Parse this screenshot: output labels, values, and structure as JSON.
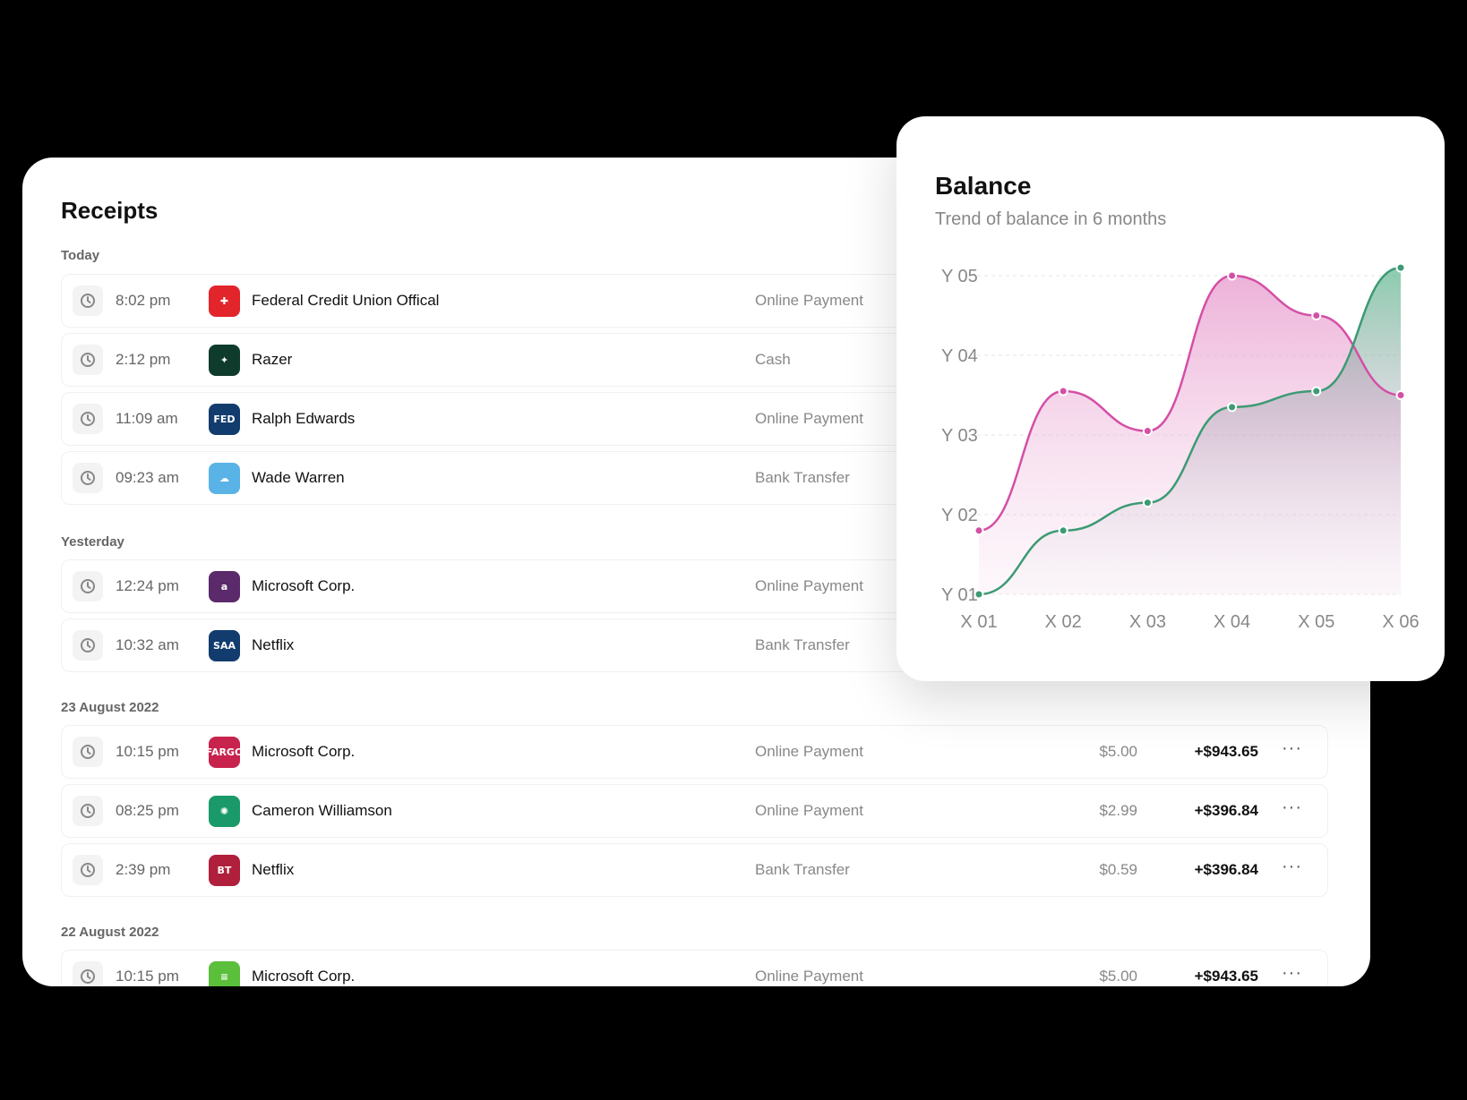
{
  "receipts": {
    "title": "Receipts",
    "groups": [
      {
        "label": "Today",
        "rows": [
          {
            "time": "8:02 pm",
            "name": "Federal Credit Union Offical",
            "method": "Online Payment",
            "fee": "",
            "amount": "",
            "logo_color": "#e2242b",
            "logo_text": "✚"
          },
          {
            "time": "2:12 pm",
            "name": "Razer",
            "method": "Cash",
            "fee": "",
            "amount": "",
            "logo_color": "#0f3b2c",
            "logo_text": "✦"
          },
          {
            "time": "11:09 am",
            "name": "Ralph Edwards",
            "method": "Online Payment",
            "fee": "",
            "amount": "",
            "logo_color": "#123c6e",
            "logo_text": "FED"
          },
          {
            "time": "09:23 am",
            "name": "Wade Warren",
            "method": "Bank Transfer",
            "fee": "",
            "amount": "",
            "logo_color": "#5ab3e6",
            "logo_text": "☁"
          }
        ]
      },
      {
        "label": "Yesterday",
        "rows": [
          {
            "time": "12:24 pm",
            "name": "Microsoft Corp.",
            "method": "Online Payment",
            "fee": "",
            "amount": "",
            "logo_color": "#5b2a6b",
            "logo_text": "a"
          },
          {
            "time": "10:32 am",
            "name": "Netflix",
            "method": "Bank Transfer",
            "fee": "",
            "amount": "",
            "logo_color": "#123c6e",
            "logo_text": "SAA"
          }
        ]
      },
      {
        "label": "23 August 2022",
        "rows": [
          {
            "time": "10:15 pm",
            "name": "Microsoft Corp.",
            "method": "Online Payment",
            "fee": "$5.00",
            "amount": "+$943.65",
            "logo_color": "#c8234d",
            "logo_text": "FARGO"
          },
          {
            "time": "08:25 pm",
            "name": "Cameron Williamson",
            "method": "Online Payment",
            "fee": "$2.99",
            "amount": "+$396.84",
            "logo_color": "#1a9a6b",
            "logo_text": "✺"
          },
          {
            "time": "2:39 pm",
            "name": "Netflix",
            "method": "Bank Transfer",
            "fee": "$0.59",
            "amount": "+$396.84",
            "logo_color": "#b01f3c",
            "logo_text": "BT"
          }
        ]
      },
      {
        "label": "22 August 2022",
        "rows": [
          {
            "time": "10:15 pm",
            "name": "Microsoft Corp.",
            "method": "Online Payment",
            "fee": "$5.00",
            "amount": "+$943.65",
            "logo_color": "#5bbf3c",
            "logo_text": "≡"
          }
        ]
      }
    ],
    "more_label": "···"
  },
  "balance": {
    "title": "Balance",
    "subtitle": "Trend of balance in 6 months"
  },
  "chart_data": {
    "type": "area",
    "categories": [
      "X 01",
      "X 02",
      "X 03",
      "X 04",
      "X 05",
      "X 06"
    ],
    "y_ticks": [
      "Y 01",
      "Y 02",
      "Y 03",
      "Y 04",
      "Y 05"
    ],
    "ylim": [
      1,
      5
    ],
    "grid": true,
    "series": [
      {
        "values": [
          1.8,
          3.55,
          3.05,
          5.0,
          4.5,
          3.5
        ],
        "color": "#d44fa6"
      },
      {
        "values": [
          1.0,
          1.8,
          2.15,
          3.35,
          3.55,
          5.1
        ],
        "color": "#3d9a73"
      }
    ]
  }
}
